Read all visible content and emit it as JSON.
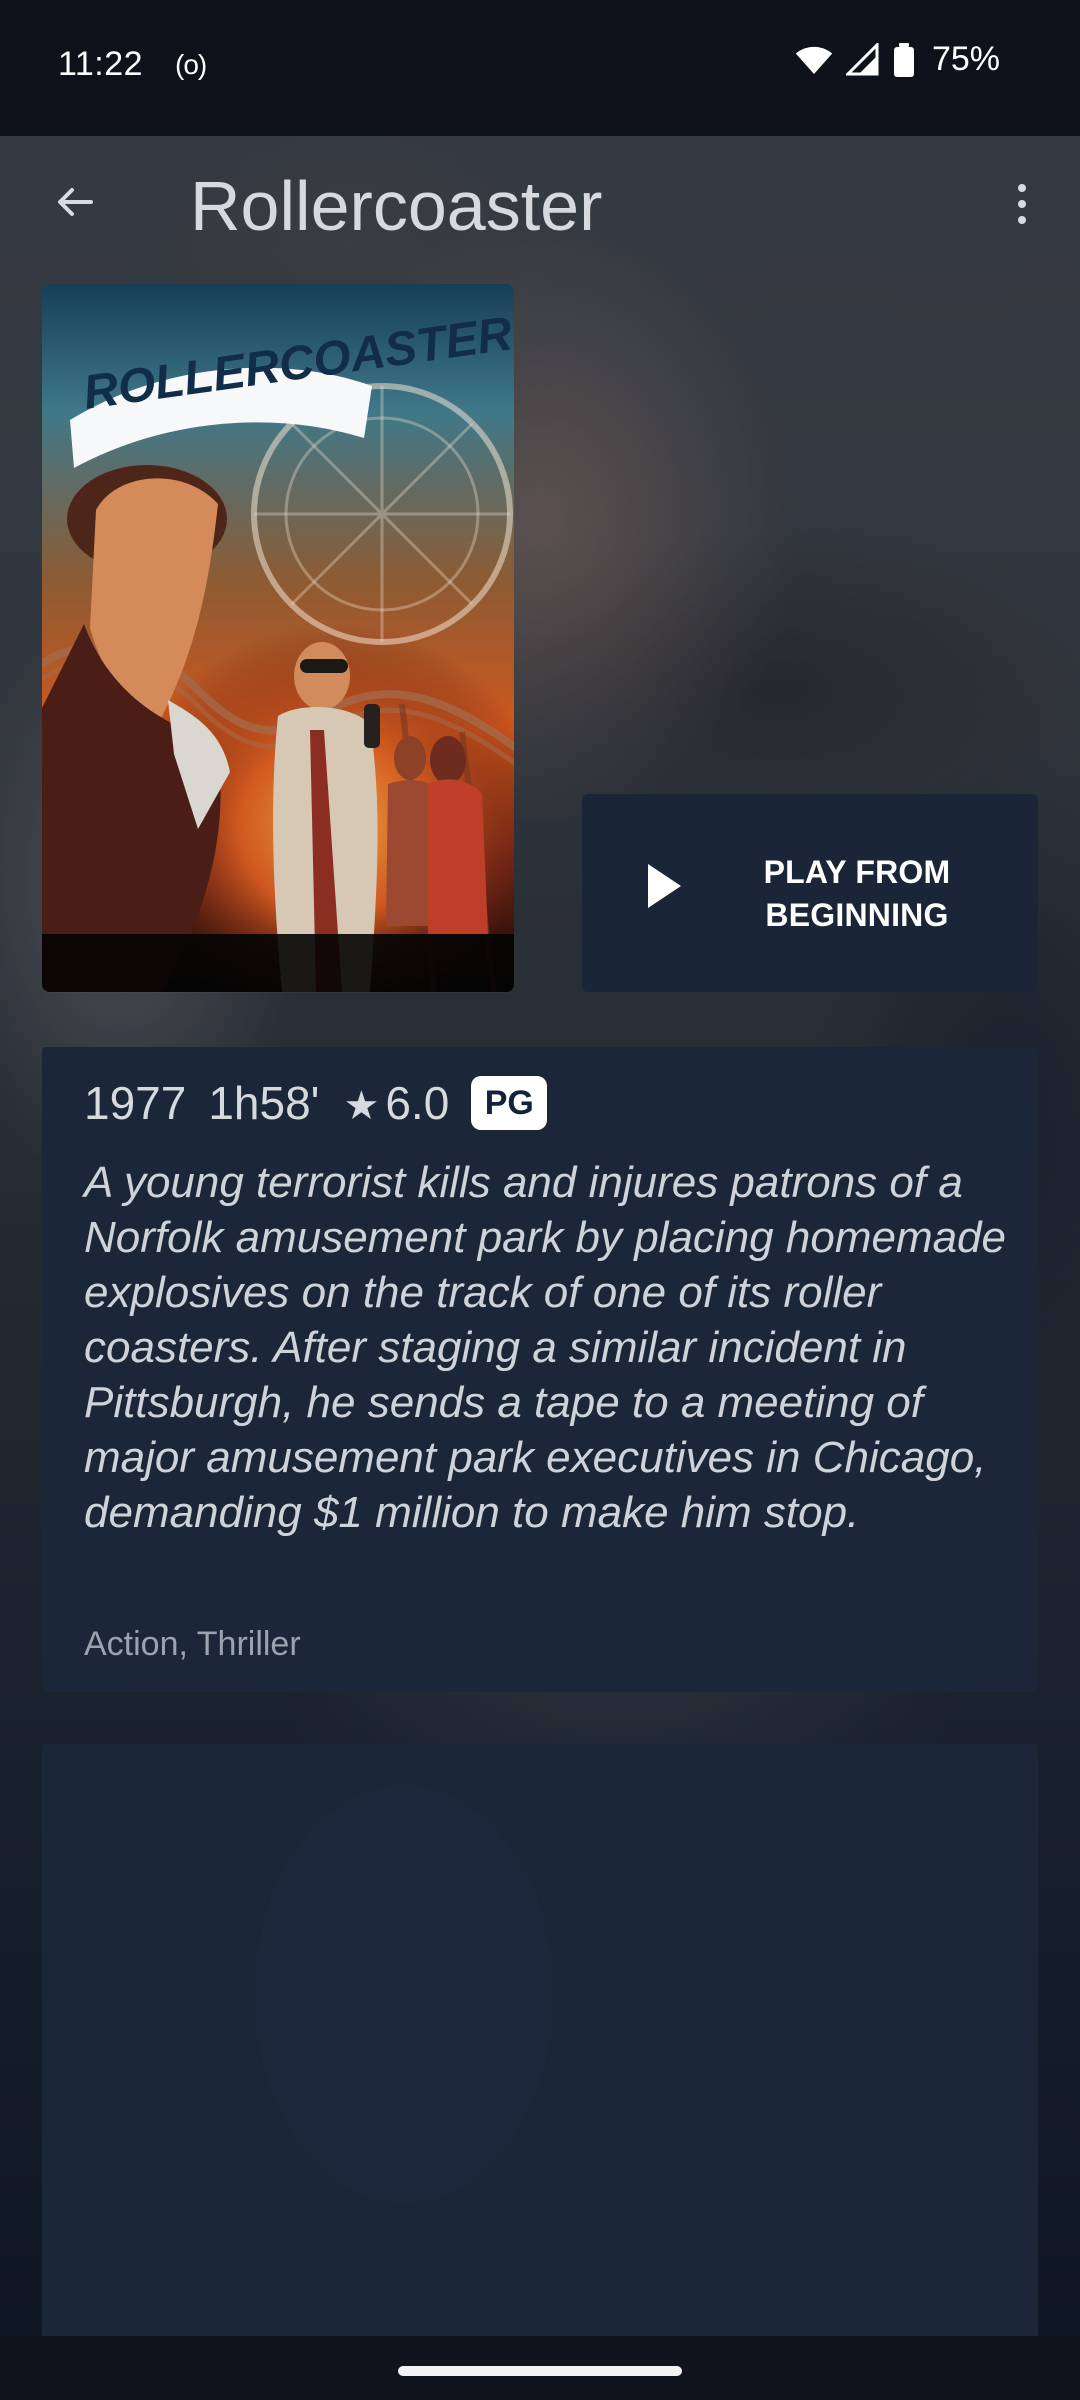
{
  "status_bar": {
    "time": "11:22",
    "radio": "(o)",
    "battery": "75%"
  },
  "header": {
    "title": "Rollercoaster"
  },
  "poster": {
    "title_art": "ROLLERCOASTER"
  },
  "actions": {
    "play_label": "PLAY FROM\nBEGINNING"
  },
  "details": {
    "year": "1977",
    "duration": "1h58'",
    "star": "★",
    "rating": "6.0",
    "badge": "PG",
    "description": "A young terrorist kills and injures patrons of a Norfolk amusement park by placing homemade explosives on the track of one of its roller coasters. After staging a similar incident in Pittsburgh, he sends a tape to a meeting of major amusement park executives in Chicago, demanding $1 million to make him stop.",
    "genres": "Action, Thriller"
  },
  "colors": {
    "background": "#0f1722",
    "card": "#1b2638",
    "button": "#1a2638",
    "text_primary": "#d6d9de",
    "text_secondary": "#9aa3ae",
    "badge_bg": "#ffffff",
    "badge_text": "#14233a"
  },
  "icons": {
    "back": "arrow-left-icon",
    "more": "more-vertical-icon",
    "play": "play-icon",
    "wifi": "wifi-icon",
    "signal": "signal-icon",
    "battery": "battery-icon"
  }
}
